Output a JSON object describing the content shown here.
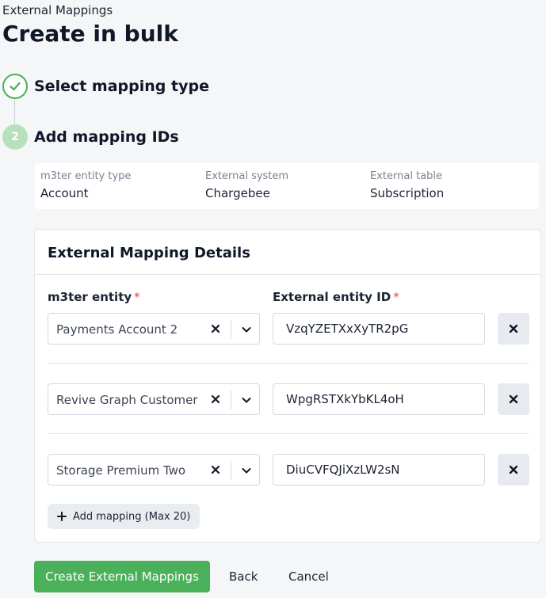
{
  "header": {
    "breadcrumb": "External Mappings",
    "title": "Create in bulk"
  },
  "steps": [
    {
      "label": "Select mapping type",
      "status": "complete",
      "icon": "check-icon"
    },
    {
      "number": "2",
      "label": "Add mapping IDs",
      "status": "active"
    }
  ],
  "summary": [
    {
      "label": "m3ter entity type",
      "value": "Account"
    },
    {
      "label": "External system",
      "value": "Chargebee"
    },
    {
      "label": "External table",
      "value": "Subscription"
    }
  ],
  "card": {
    "title": "External Mapping Details",
    "entity_label": "m3ter entity",
    "external_id_label": "External entity ID",
    "required_marker": "*",
    "rows": [
      {
        "entity": "Payments Account 2",
        "external_id": "VzqYZETXxXyTR2pG"
      },
      {
        "entity": "Revive Graph Customer",
        "external_id": "WpgRSTXkYbKL4oH"
      },
      {
        "entity": "Storage Premium Two",
        "external_id": "DiuCVFQJiXzLW2sN"
      }
    ],
    "add_button": "Add mapping (Max 20)"
  },
  "actions": {
    "create": "Create External Mappings",
    "back": "Back",
    "cancel": "Cancel"
  },
  "colors": {
    "primary": "#4bb05a",
    "required": "#e0453a",
    "step_active": "#b7e0bd"
  }
}
